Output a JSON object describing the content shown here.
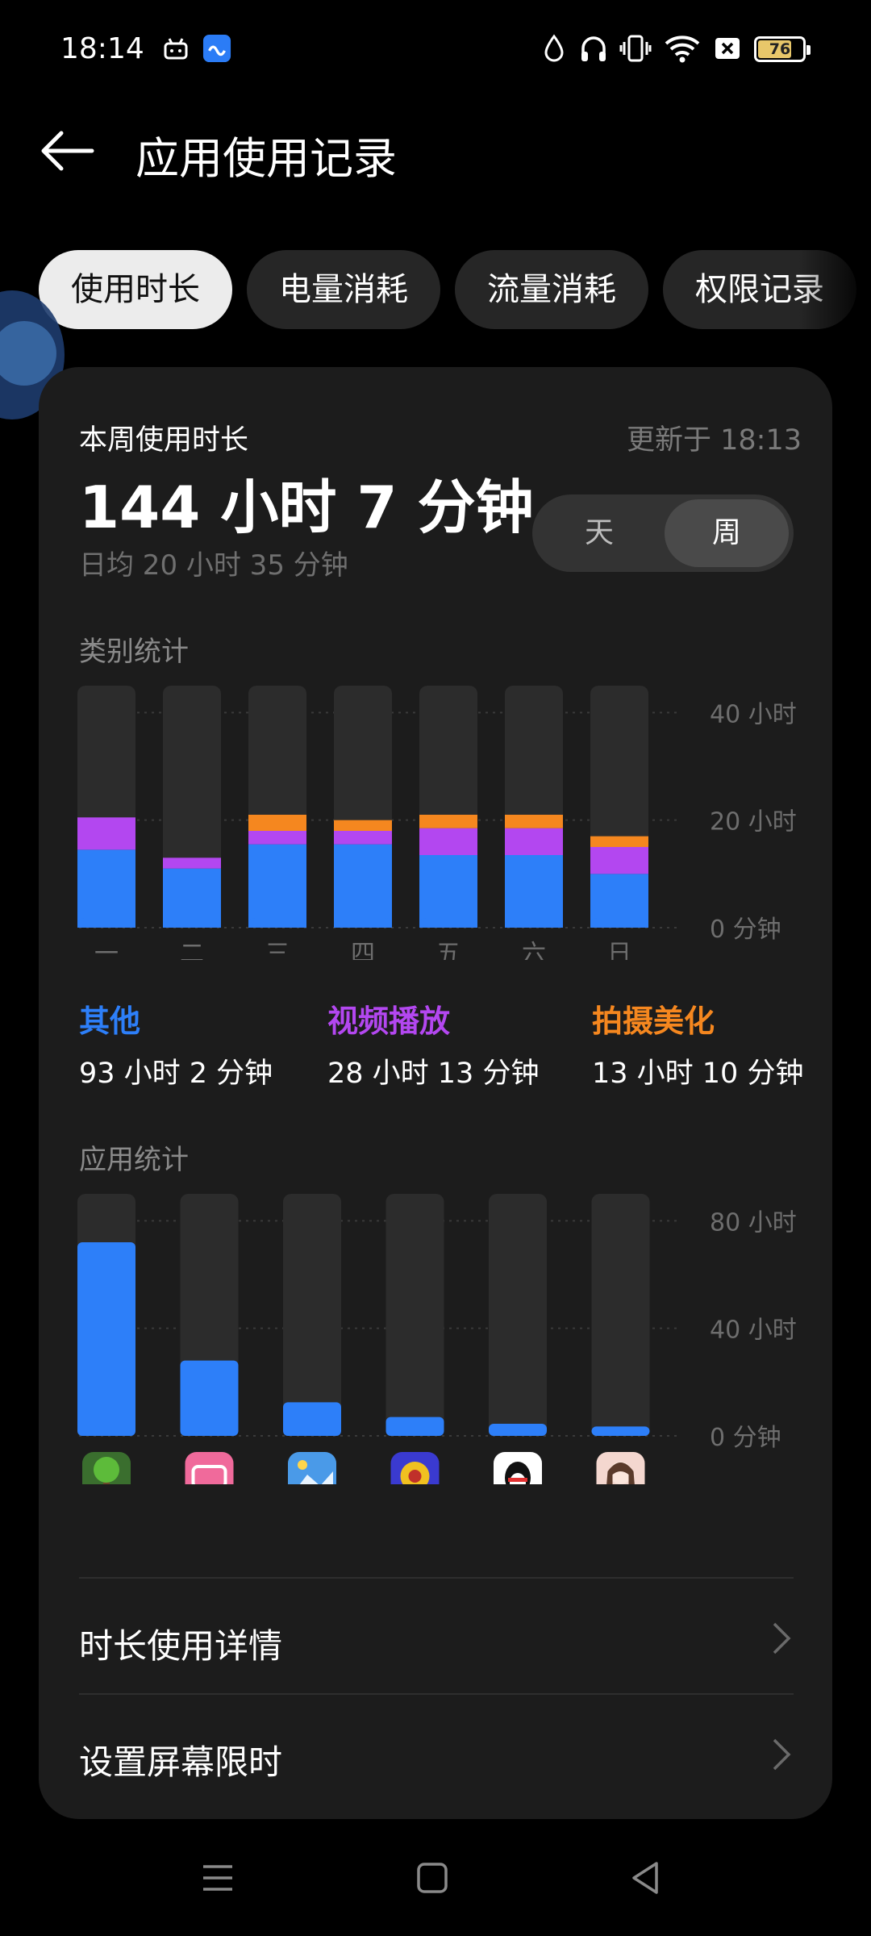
{
  "status_bar": {
    "time": "18:14",
    "battery": "76",
    "battery_level": 0.76,
    "icons": [
      "android-icon",
      "cloud-app-icon",
      "water-drop-icon",
      "headphones-icon",
      "vibrate-icon",
      "wifi-icon",
      "sim-off-icon",
      "battery-icon"
    ]
  },
  "header": {
    "title": "应用使用记录",
    "back_icon": "arrow-left-icon"
  },
  "tabs": [
    {
      "label": "使用时长",
      "active": true
    },
    {
      "label": "电量消耗",
      "active": false
    },
    {
      "label": "流量消耗",
      "active": false
    },
    {
      "label": "权限记录",
      "active": false
    }
  ],
  "summary": {
    "label": "本周使用时长",
    "updated": "更新于 18:13",
    "total": "144 小时 7 分钟",
    "average": "日均 20 小时 35 分钟",
    "range_options": [
      {
        "label": "天",
        "active": false
      },
      {
        "label": "周",
        "active": true
      }
    ]
  },
  "category_chart": {
    "section_label": "类别统计",
    "colors": {
      "other": "#2d7ff9",
      "video": "#b347f0",
      "photo": "#f5871f",
      "track": "#2c2c2c"
    }
  },
  "app_chart": {
    "section_label": "应用统计",
    "color": "#2d7ff9",
    "apps": [
      {
        "icon": "terraria-app-icon",
        "color": "#3a6e2e"
      },
      {
        "icon": "bilibili-app-icon",
        "color": "#f06a9b"
      },
      {
        "icon": "gallery-app-icon",
        "color": "#4a9ae8"
      },
      {
        "icon": "game-app-icon",
        "color": "#3a3ad0"
      },
      {
        "icon": "qq-app-icon",
        "color": "#ffffff"
      },
      {
        "icon": "avatar-app-icon",
        "color": "#f4d7cf"
      }
    ]
  },
  "chart_data": [
    {
      "type": "bar",
      "stacked": true,
      "title": "类别统计",
      "categories": [
        "一",
        "二",
        "三",
        "四",
        "五",
        "六",
        "日"
      ],
      "series": [
        {
          "name": "其他",
          "values": [
            14.5,
            11,
            15.5,
            15.5,
            13.5,
            13.5,
            10
          ]
        },
        {
          "name": "视频播放",
          "values": [
            6,
            2,
            2.5,
            2.5,
            5,
            5,
            5
          ]
        },
        {
          "name": "拍摄美化",
          "values": [
            0,
            0,
            3,
            2,
            2.5,
            2.5,
            2
          ]
        }
      ],
      "ylim": [
        0,
        45
      ],
      "yticks": [
        "0 分钟",
        "20 小时",
        "40 小时"
      ],
      "ytick_values": [
        0,
        20,
        40
      ],
      "totals": [
        {
          "name": "其他",
          "value": "93 小时 2 分钟"
        },
        {
          "name": "视频播放",
          "value": "28 小时 13 分钟"
        },
        {
          "name": "拍摄美化",
          "value": "13 小时 10 分钟"
        }
      ]
    },
    {
      "type": "bar",
      "title": "应用统计",
      "categories": [
        "terraria",
        "bilibili",
        "gallery",
        "game",
        "qq",
        "avatar"
      ],
      "values": [
        72,
        28,
        12.5,
        7,
        4.5,
        3.5
      ],
      "ylim": [
        0,
        90
      ],
      "yticks": [
        "0 分钟",
        "40 小时",
        "80 小时"
      ],
      "ytick_values": [
        0,
        40,
        80
      ]
    }
  ],
  "rows": [
    {
      "label": "时长使用详情"
    },
    {
      "label": "设置屏幕限时"
    }
  ],
  "nav": [
    "menu-icon",
    "home-icon",
    "back-icon"
  ]
}
